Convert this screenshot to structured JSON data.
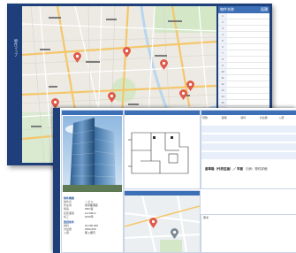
{
  "app": {
    "title": "物件マップ",
    "accent": "#1e3f7a",
    "header_blue": "#3d6fb6"
  },
  "map": {
    "pin_color": "#e05a4a",
    "pins": [
      {
        "name": "pin-1"
      },
      {
        "name": "pin-2"
      },
      {
        "name": "pin-3"
      },
      {
        "name": "pin-4"
      },
      {
        "name": "pin-5"
      },
      {
        "name": "pin-6"
      },
      {
        "name": "pin-7"
      }
    ]
  },
  "list": {
    "header_left": "物件名称",
    "header_right": "面積",
    "row_numbers": [
      "1",
      "2",
      "3",
      "4",
      "5",
      "6",
      "7",
      "8",
      "9",
      "10",
      "11",
      "12",
      "13",
      "14",
      "15",
      "16",
      "17",
      "18",
      "19",
      "20",
      "21",
      "22",
      "23",
      "24",
      "25",
      "26"
    ]
  },
  "detail": {
    "section_basic": "物件概要",
    "fields_basic": [
      {
        "k": "物件名",
        "v": "○○ビル"
      },
      {
        "k": "所在地",
        "v": "東京都港区"
      },
      {
        "k": "構造",
        "v": "SRC造"
      },
      {
        "k": "延床面積",
        "v": "12,345m²"
      },
      {
        "k": "竣工",
        "v": "2010年"
      }
    ],
    "section_contract": "賃貸条件",
    "fields_contract": [
      {
        "k": "賃料",
        "v": "¥2,000,000"
      },
      {
        "k": "共益費",
        "v": "¥300,000"
      },
      {
        "k": "入居",
        "v": "即入居可"
      }
    ],
    "table_headers": [
      "階数",
      "面積",
      "賃料",
      "共益費",
      "入居"
    ],
    "table_footer_title": "基準階（代表区画）／ 平面",
    "table_footer_note": "凡例：物件詳細",
    "note_label": "備考"
  }
}
